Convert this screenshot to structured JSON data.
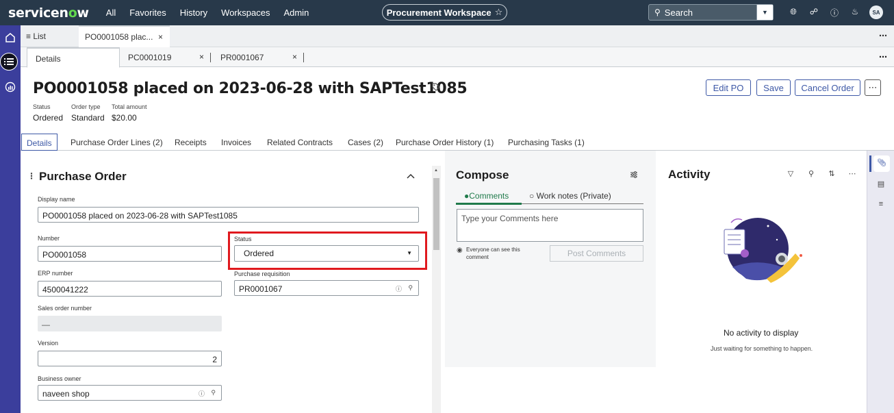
{
  "brand": {
    "name_a": "servicen",
    "name_o": "o",
    "name_b": "w"
  },
  "topnav": [
    "All",
    "Favorites",
    "History",
    "Workspaces",
    "Admin"
  ],
  "workspace": {
    "label": "Procurement Workspace",
    "star": "☆"
  },
  "search": {
    "placeholder": "Search"
  },
  "user": {
    "initials": "SA"
  },
  "tabs_row1": {
    "list_label": "List",
    "record_tab": "PO0001058 plac...",
    "close": "×",
    "more": "⋯"
  },
  "tabs_row2": [
    {
      "label": "Details"
    },
    {
      "label": "PC0001019"
    },
    {
      "label": "PR0001067"
    }
  ],
  "record": {
    "title": "PO0001058 placed on 2023-06-28 with SAPTest1085",
    "meta": [
      {
        "label": "Status",
        "value": "Ordered"
      },
      {
        "label": "Order type",
        "value": "Standard"
      },
      {
        "label": "Total amount",
        "value": "$20.00"
      }
    ]
  },
  "actions": {
    "edit": "Edit PO",
    "save": "Save",
    "cancel": "Cancel Order",
    "more": "⋯"
  },
  "detail_tabs": [
    "Details",
    "Purchase Order Lines (2)",
    "Receipts",
    "Invoices",
    "Related Contracts",
    "Cases (2)",
    "Purchase Order History (1)",
    "Purchasing Tasks (1)"
  ],
  "form": {
    "section_title": "Purchase Order",
    "display_name": {
      "label": "Display name",
      "value": "PO0001058 placed on 2023-06-28 with SAPTest1085"
    },
    "number": {
      "label": "Number",
      "value": "PO0001058"
    },
    "status": {
      "label": "Status",
      "value": "Ordered"
    },
    "erp_number": {
      "label": "ERP number",
      "value": "4500041222"
    },
    "purchase_requisition": {
      "label": "Purchase requisition",
      "value": "PR0001067"
    },
    "sales_order_number": {
      "label": "Sales order number",
      "value": "—"
    },
    "version": {
      "label": "Version",
      "value": "2"
    },
    "business_owner": {
      "label": "Business owner",
      "value": "naveen shop"
    }
  },
  "compose": {
    "title": "Compose",
    "tab_comments": "Comments",
    "tab_worknotes": "Work notes (Private)",
    "placeholder": "Type your Comments here",
    "visibility_note": "Everyone can see this comment",
    "post_label": "Post Comments"
  },
  "activity": {
    "title": "Activity",
    "empty_title": "No activity to display",
    "empty_sub": "Just waiting for something to happen."
  },
  "colors": {
    "topbar": "#28394a",
    "rail": "#3b3e9c",
    "accent": "#3d58a6",
    "highlight": "#e0191e",
    "green": "#1f7a4a"
  }
}
